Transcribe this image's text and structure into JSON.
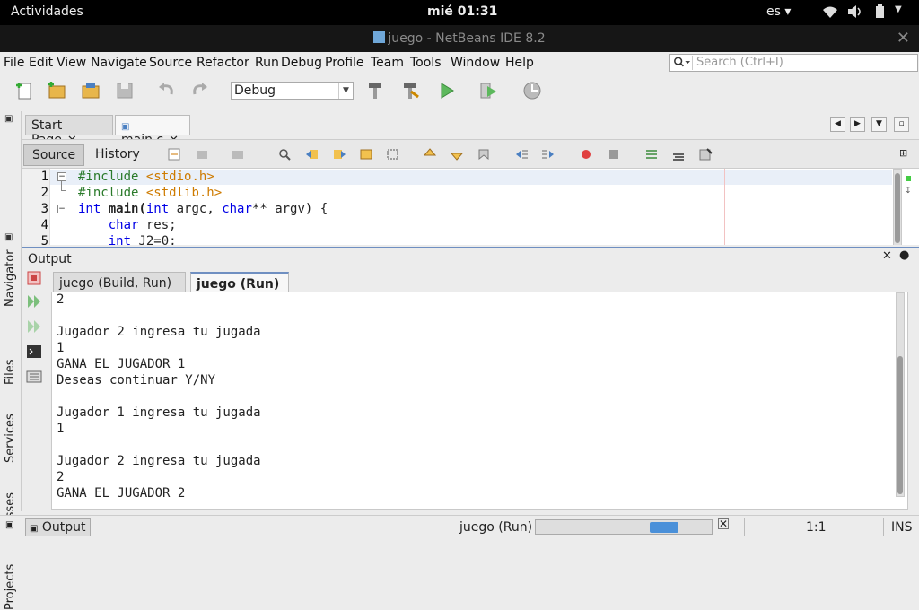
{
  "system": {
    "activities": "Actividades",
    "clock": "mié 01:31",
    "lang": "es ▾",
    "wifi_icon": "wifi-icon",
    "volume_icon": "volume-icon",
    "battery_icon": "battery-icon"
  },
  "window": {
    "title": "juego - NetBeans IDE 8.2",
    "close": "✕"
  },
  "menu": [
    "File",
    "Edit",
    "View",
    "Navigate",
    "Source",
    "Refactor",
    "Run",
    "Debug",
    "Profile",
    "Team",
    "Tools",
    "Window",
    "Help"
  ],
  "search": {
    "placeholder": "Search (Ctrl+I)"
  },
  "toolbar": {
    "config": "Debug"
  },
  "editor_tabs": [
    {
      "label": "Start Page",
      "close": "✕"
    },
    {
      "label": "main.c",
      "close": "✕"
    }
  ],
  "editor_modes": {
    "source": "Source",
    "history": "History"
  },
  "code": {
    "line_numbers": [
      "1",
      "2",
      "3",
      "4",
      "5"
    ],
    "l1_pp": "#include",
    "l1_str": "<stdio.h>",
    "l2_pp": "#include",
    "l2_str": "<stdlib.h>",
    "l3_a": "int",
    "l3_b": " main(",
    "l3_c": "int",
    "l3_d": " argc, ",
    "l3_e": "char",
    "l3_f": "** argv) {",
    "l4_a": "char",
    "l4_b": " res;",
    "l5_a": "int",
    "l5_b": " J2=0;"
  },
  "output": {
    "title": "Output",
    "tabs": [
      {
        "label": "juego (Build, Run)",
        "close": "✕"
      },
      {
        "label": "juego (Run)",
        "close": "✕"
      }
    ],
    "lines": [
      "2",
      "",
      "Jugador 2 ingresa tu jugada",
      "1",
      "GANA EL JUGADOR 1",
      "Deseas continuar Y/NY",
      "",
      "Jugador 1 ingresa tu jugada",
      "1",
      "",
      "Jugador 2 ingresa tu jugada",
      "2",
      "GANA EL JUGADOR 2"
    ]
  },
  "side_tabs": {
    "navigator": "Navigator",
    "files": "Files",
    "services": "Services",
    "classes": "Classes",
    "projects": "Projects"
  },
  "status": {
    "output_btn": "Output",
    "task": "juego (Run)",
    "position": "1:1",
    "mode": "INS",
    "progress_fraction": 0.73
  }
}
